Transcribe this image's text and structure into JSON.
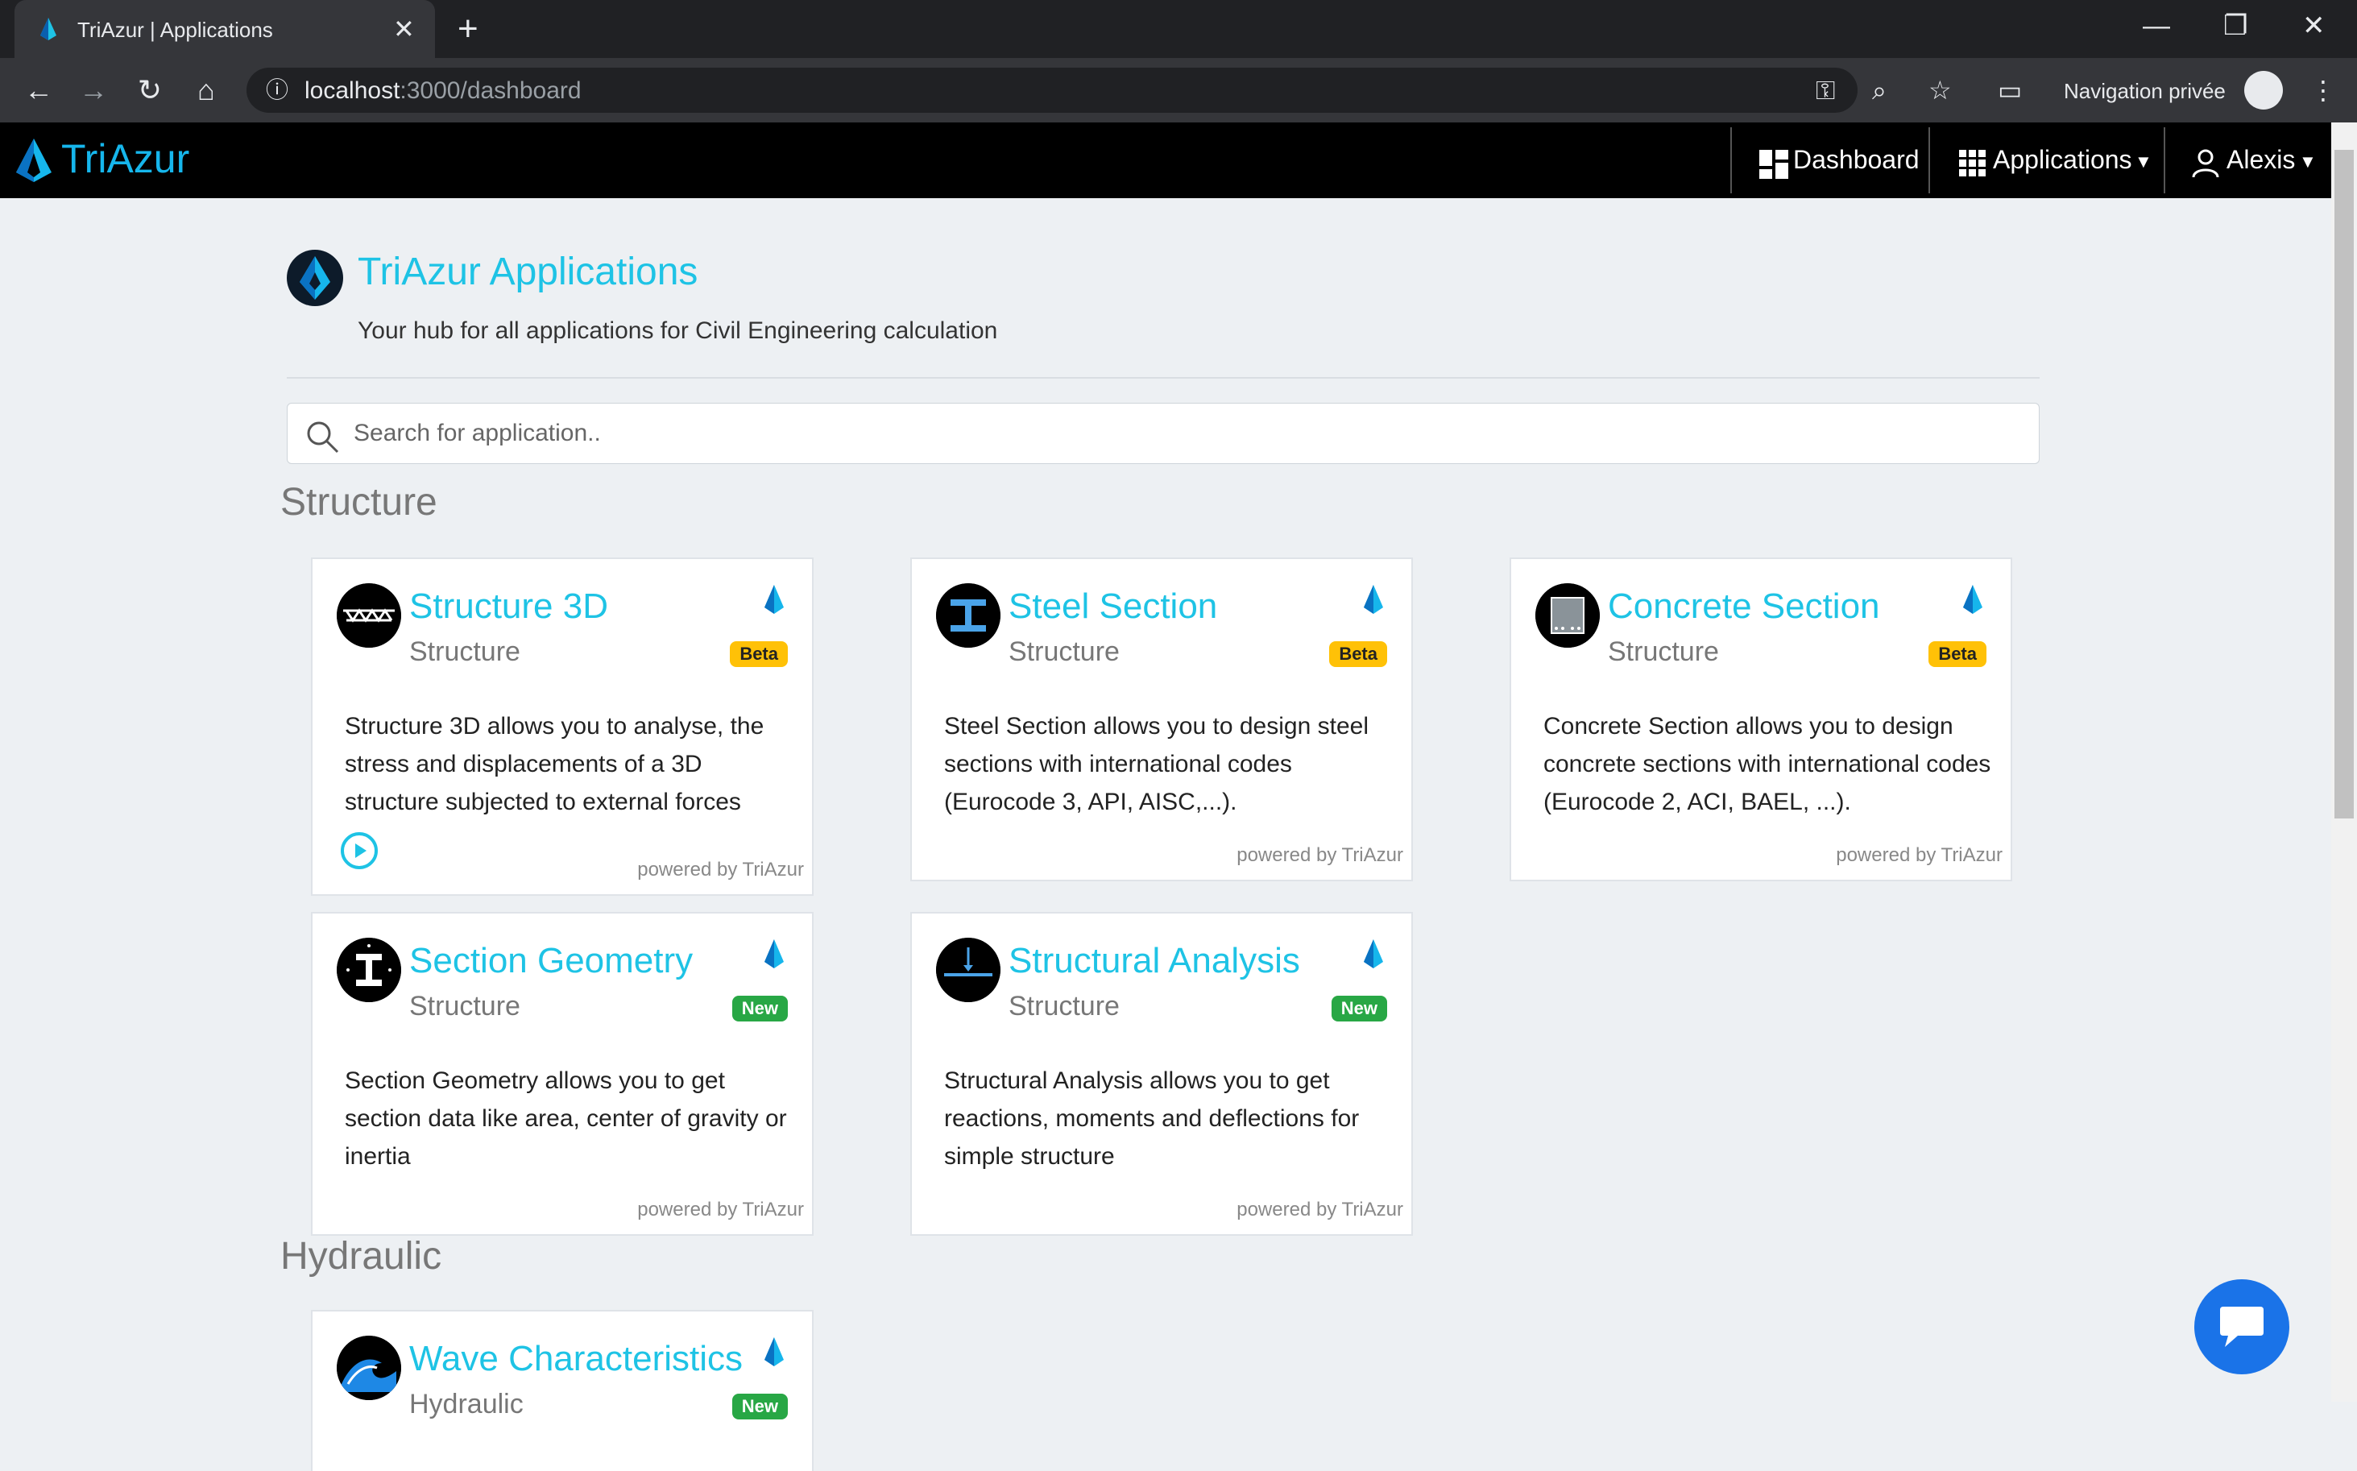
{
  "browser": {
    "tab_title": "TriAzur | Applications",
    "url_host": "localhost",
    "url_path": ":3000/dashboard",
    "incognito_label": "Navigation privée"
  },
  "navbar": {
    "brand": "TriAzur",
    "dashboard_label": "Dashboard",
    "applications_label": "Applications",
    "user_label": "Alexis"
  },
  "header": {
    "title": "TriAzur Applications",
    "subtitle": "Your hub for all applications for Civil Engineering calculation"
  },
  "search": {
    "placeholder": "Search for application.."
  },
  "sections": [
    {
      "title": "Structure",
      "cards": [
        {
          "name": "Structure 3D",
          "category": "Structure",
          "badge": "Beta",
          "description": "Structure 3D allows you to analyse, the stress and displacements of a 3D structure subjected to external forces",
          "powered": "powered by TriAzur"
        },
        {
          "name": "Steel Section",
          "category": "Structure",
          "badge": "Beta",
          "description": "Steel Section allows you to design steel sections with international codes (Eurocode 3, API, AISC,...).",
          "powered": "powered by TriAzur"
        },
        {
          "name": "Concrete Section",
          "category": "Structure",
          "badge": "Beta",
          "description": "Concrete Section allows you to design concrete sections with international codes (Eurocode 2, ACI, BAEL, ...).",
          "powered": "powered by TriAzur"
        },
        {
          "name": "Section Geometry",
          "category": "Structure",
          "badge": "New",
          "description": "Section Geometry allows you to get section data like area, center of gravity or inertia",
          "powered": "powered by TriAzur"
        },
        {
          "name": "Structural Analysis",
          "category": "Structure",
          "badge": "New",
          "description": "Structural Analysis allows you to get reactions, moments and deflections for simple structure",
          "powered": "powered by TriAzur"
        }
      ]
    },
    {
      "title": "Hydraulic",
      "cards": [
        {
          "name": "Wave Characteristics",
          "category": "Hydraulic",
          "badge": "New"
        }
      ]
    }
  ],
  "colors": {
    "accent": "#1ec3e5",
    "brand": "#16b6ec",
    "beta": "#ffc107",
    "new": "#28a745"
  }
}
